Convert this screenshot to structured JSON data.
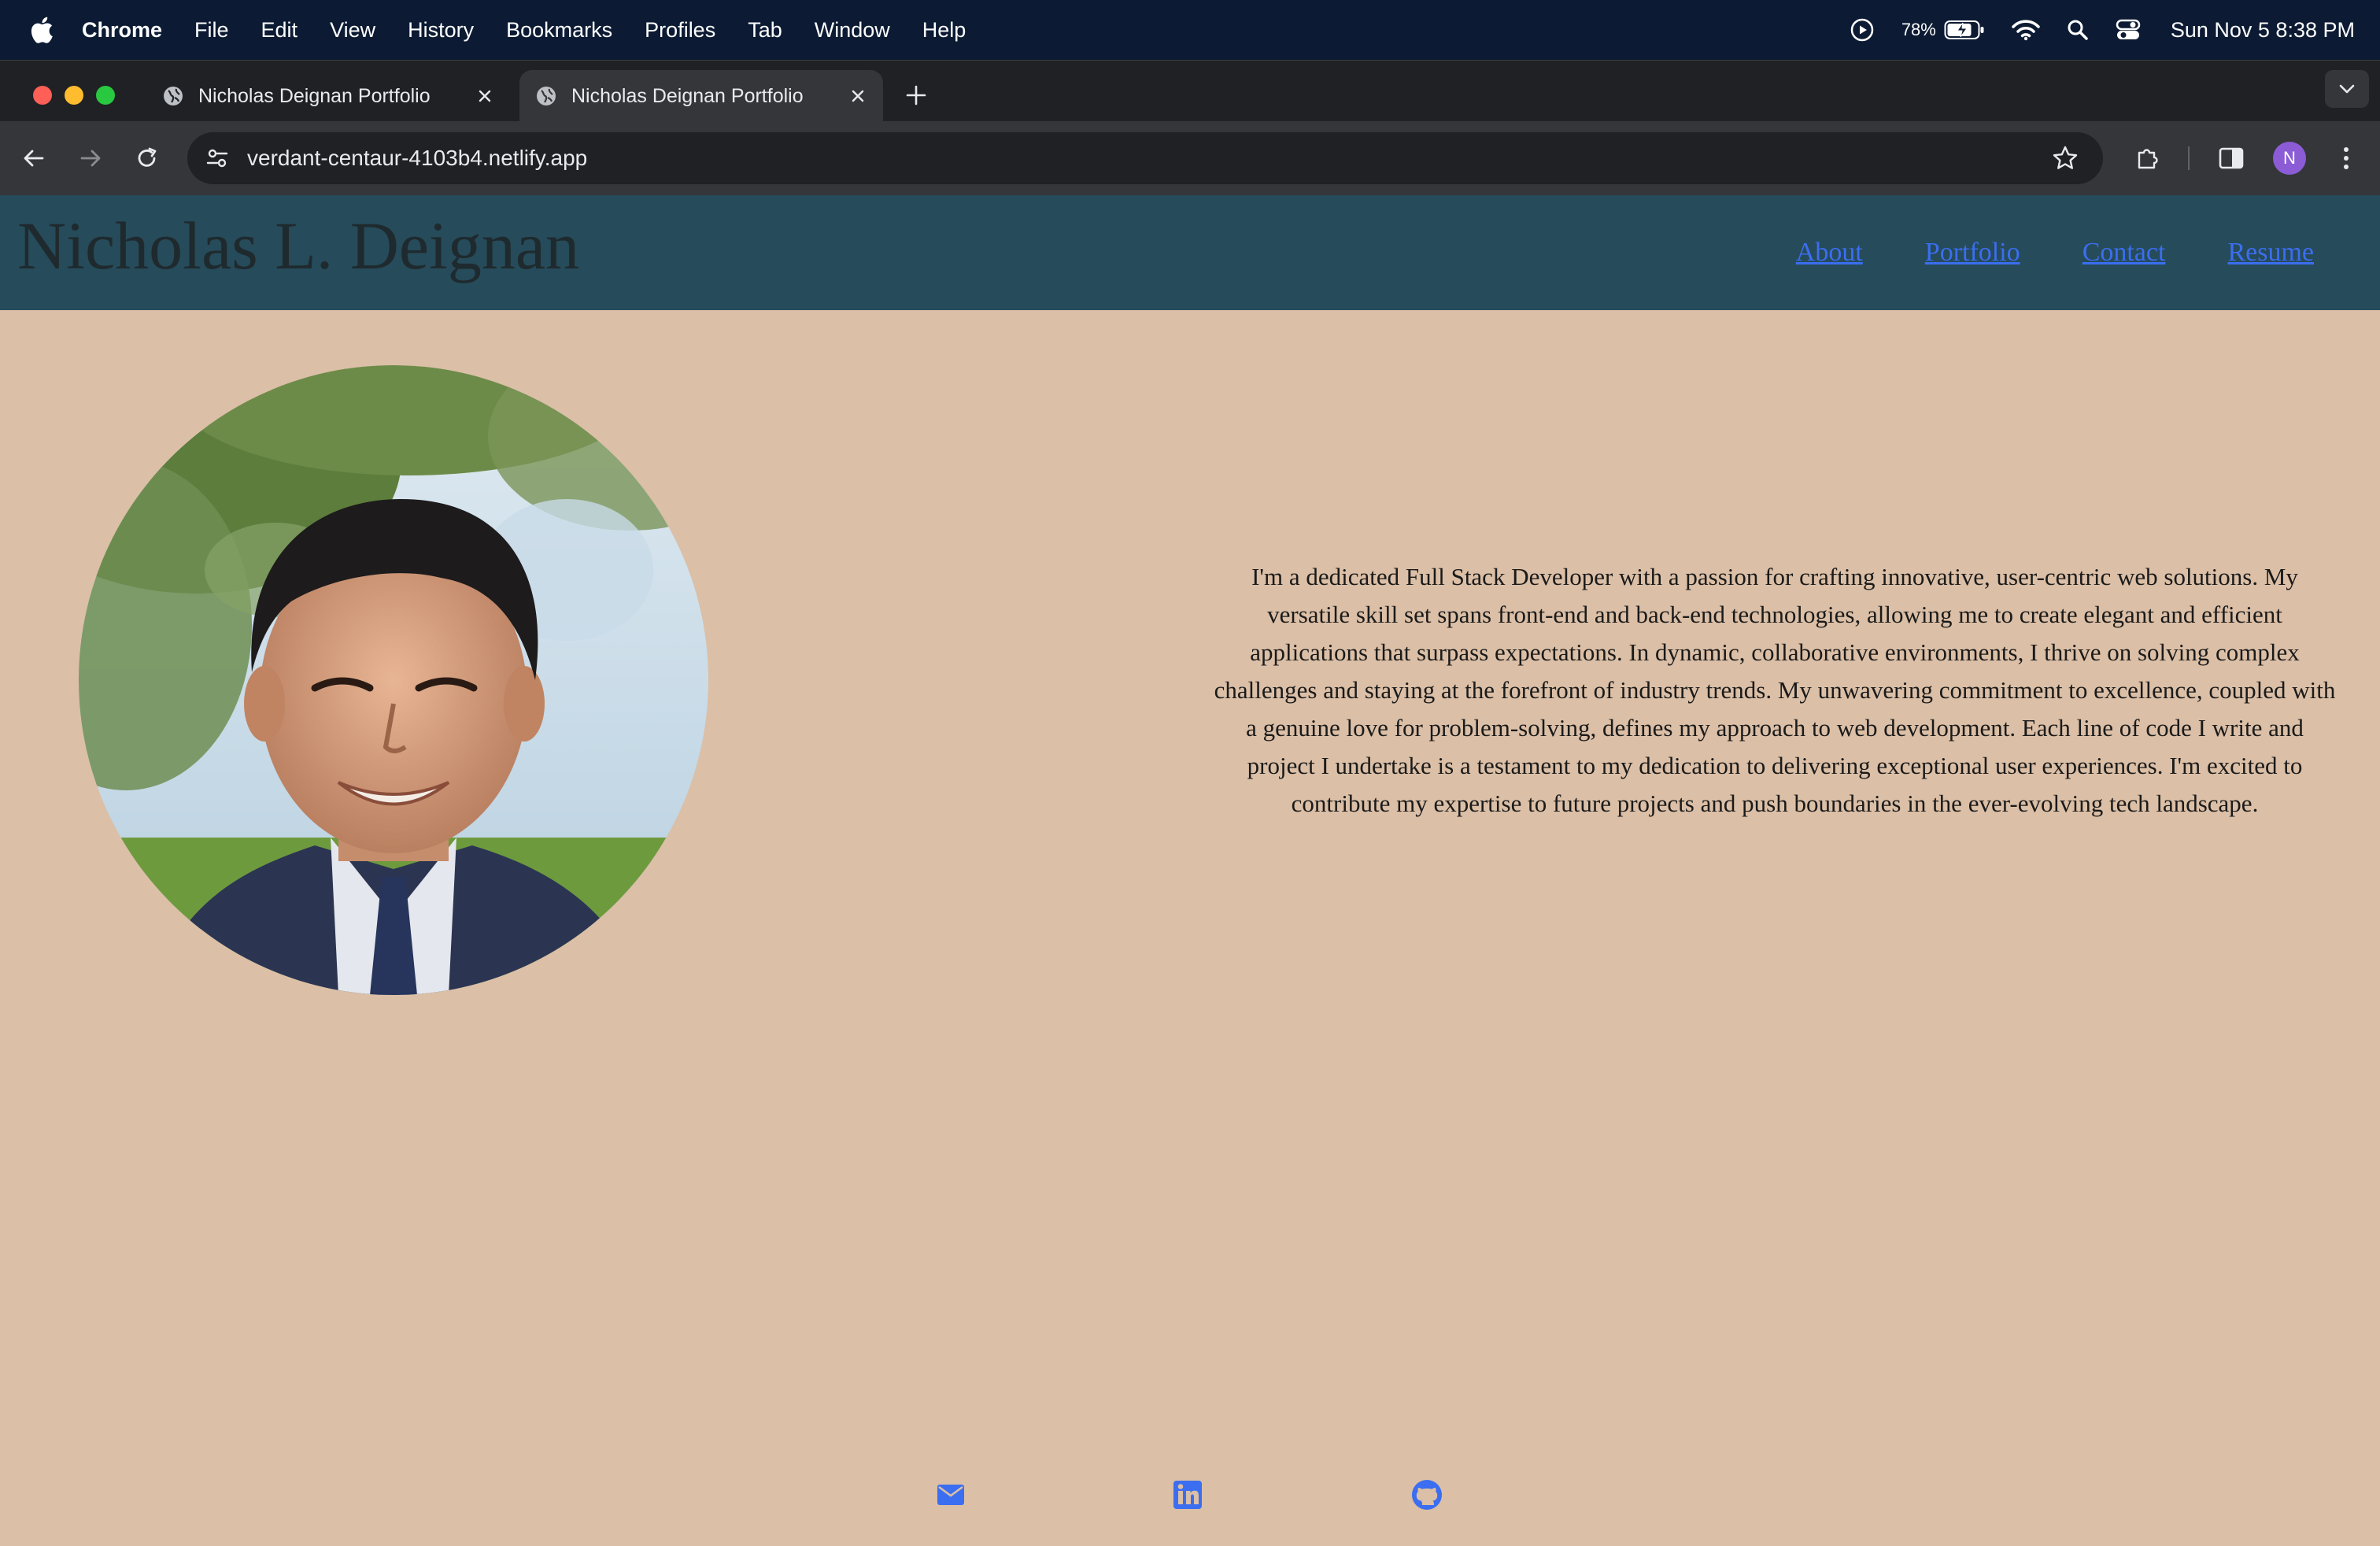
{
  "menubar": {
    "app_name": "Chrome",
    "items": [
      "File",
      "Edit",
      "View",
      "History",
      "Bookmarks",
      "Profiles",
      "Tab",
      "Window",
      "Help"
    ],
    "battery_percent": "78%",
    "clock": "Sun Nov 5  8:38 PM"
  },
  "browser": {
    "tabs": [
      {
        "title": "Nicholas Deignan Portfolio",
        "active": false
      },
      {
        "title": "Nicholas Deignan Portfolio",
        "active": true
      }
    ],
    "url": "verdant-centaur-4103b4.netlify.app",
    "profile_initial": "N"
  },
  "site": {
    "title": "Nicholas L. Deignan",
    "nav": [
      "About",
      "Portfolio",
      "Contact",
      "Resume"
    ],
    "bio": "I'm a dedicated Full Stack Developer with a passion for crafting innovative, user-centric web solutions. My versatile skill set spans front-end and back-end technologies, allowing me to create elegant and efficient applications that surpass expectations. In dynamic, collaborative environments, I thrive on solving complex challenges and staying at the forefront of industry trends. My unwavering commitment to excellence, coupled with a genuine love for problem-solving, defines my approach to web development. Each line of code I write and project I undertake is a testament to my dedication to delivering exceptional user experiences. I'm excited to contribute my expertise to future projects and push boundaries in the ever-evolving tech landscape.",
    "social": [
      "email-icon",
      "linkedin-icon",
      "github-icon"
    ]
  },
  "colors": {
    "header_bg": "#264b5a",
    "page_bg": "#dbbfa6",
    "link": "#3b6ef0",
    "social_icon": "#3b6ef0"
  }
}
